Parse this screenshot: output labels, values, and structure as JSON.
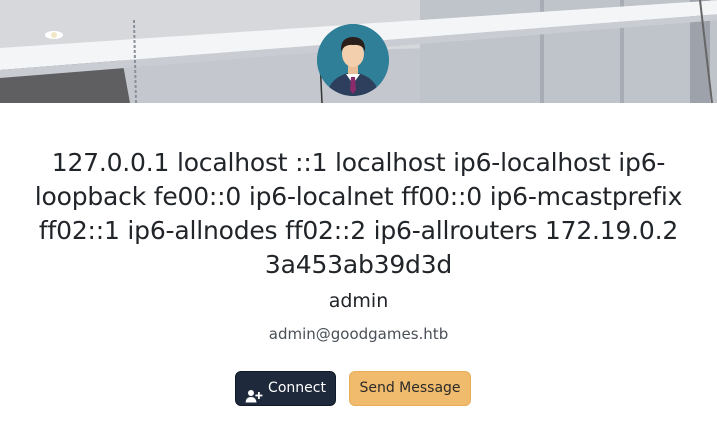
{
  "profile": {
    "display_name": "127.0.0.1 localhost ::1 localhost ip6-localhost ip6-loopback fe00::0 ip6-localnet ff00::0 ip6-mcastprefix ff02::1 ip6-allnodes ff02::2 ip6-allrouters 172.19.0.2 3a453ab39d3d",
    "username": "admin",
    "email": "admin@goodgames.htb"
  },
  "actions": {
    "connect_label": "Connect",
    "connect_icon": "user-plus-icon",
    "message_label": "Send Message"
  },
  "colors": {
    "connect_bg": "#1e293b",
    "message_bg": "#f0bb6c"
  }
}
